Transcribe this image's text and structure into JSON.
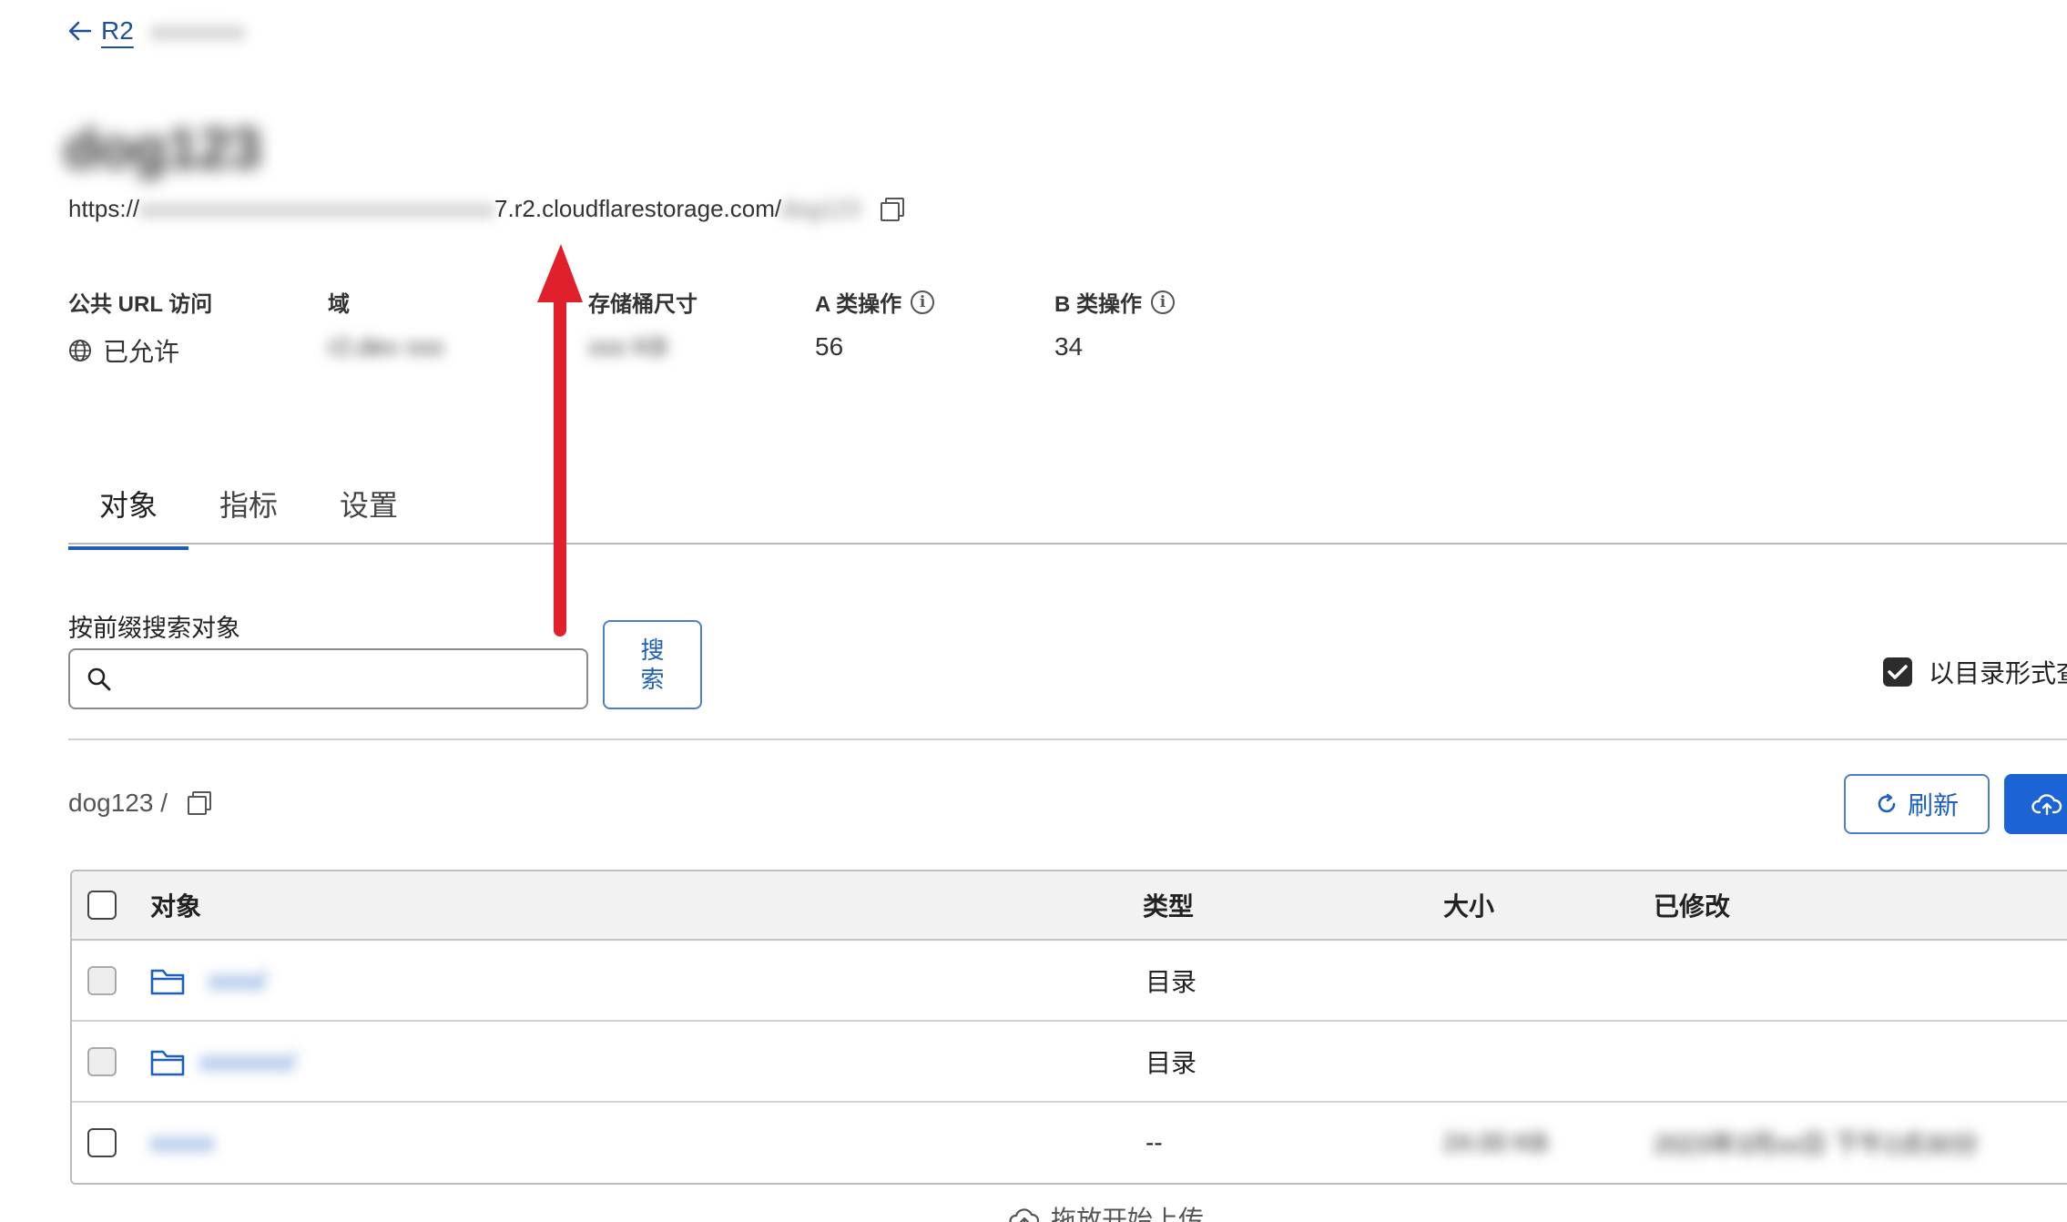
{
  "breadcrumb": {
    "back_label": "R2",
    "account": "xxxxxxxx"
  },
  "bucket": {
    "name": "dog123",
    "endpoint_prefix": "https://",
    "endpoint_hidden": "xxxxxxxxxxxxxxxxxxxxxxxxxxxxxx",
    "endpoint_suffix": "7.r2.cloudflarestorage.com/",
    "endpoint_tail": "dog123"
  },
  "meta": {
    "public_url_label": "公共 URL 访问",
    "public_url_value": "已允许",
    "domain_label": "域",
    "domain_value": "r2.dev xxx",
    "storage_label": "存储桶尺寸",
    "storage_value": "xxx KB",
    "class_a_label": "A 类操作",
    "class_a_value": "56",
    "class_b_label": "B 类操作",
    "class_b_value": "34"
  },
  "tabs": [
    {
      "label": "对象",
      "active": true
    },
    {
      "label": "指标",
      "active": false
    },
    {
      "label": "设置",
      "active": false
    }
  ],
  "search": {
    "label": "按前缀搜索对象",
    "placeholder": "",
    "button_label": "搜索"
  },
  "directory_toggle": {
    "label": "以目录形式查看",
    "checked": true
  },
  "path": {
    "label": "dog123 /"
  },
  "actions": {
    "refresh_label": "刷新"
  },
  "table": {
    "headers": {
      "object": "对象",
      "type": "类型",
      "size": "大小",
      "modified": "已修改"
    },
    "rows": [
      {
        "name": "xxxx/",
        "type": "目录",
        "size": "",
        "modified": ""
      },
      {
        "name": "xxxxxxx/",
        "type": "目录",
        "size": "",
        "modified": ""
      },
      {
        "name": "xxxxx",
        "type": "--",
        "size": "24.00 KB",
        "modified": "2023年3月xx日 下午2点30分"
      }
    ]
  },
  "dropzone": {
    "label": "拖放开始上传"
  },
  "colors": {
    "accent": "#1c5fbd",
    "annotation_arrow": "#e0202a"
  }
}
